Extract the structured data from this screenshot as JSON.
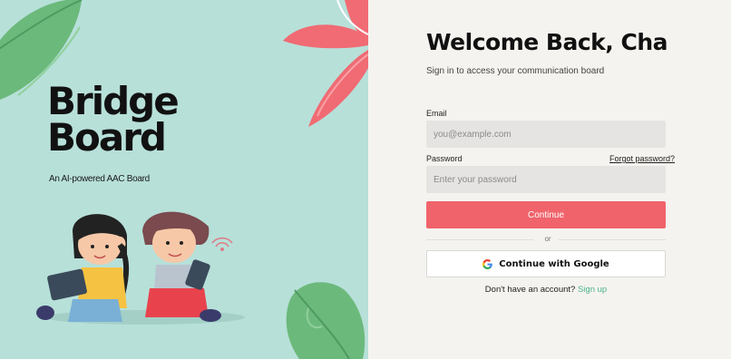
{
  "brand": {
    "line1": "Bridge",
    "line2": "Board",
    "tagline": "An AI-powered AAC Board"
  },
  "login": {
    "title": "Welcome Back, Cha",
    "subtitle": "Sign in to access your communication board",
    "email_label": "Email",
    "email_placeholder": "you@example.com",
    "password_label": "Password",
    "password_placeholder": "Enter your password",
    "forgot_label": "Forgot password?",
    "continue_label": "Continue",
    "or_label": "or",
    "google_label": "Continue with Google",
    "no_account_text": "Don't have an account?",
    "signup_label": "Sign up"
  },
  "colors": {
    "left_bg": "#b7e0d9",
    "primary": "#f0636b",
    "link": "#4bb38e",
    "leaf": "#6cb97c",
    "flower": "#f06b74"
  },
  "icons": [
    "leaf-icon",
    "flower-icon",
    "google-icon",
    "wifi-signal-icon"
  ]
}
